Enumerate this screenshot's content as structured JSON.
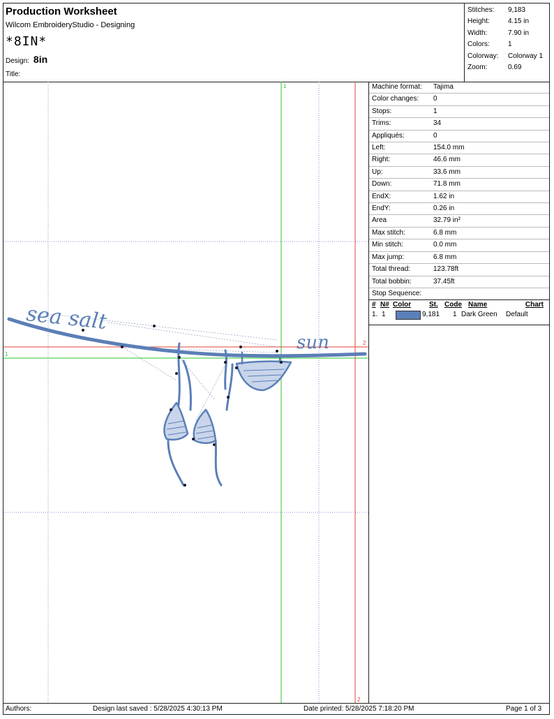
{
  "header": {
    "title": "Production Worksheet",
    "subtitle": "Wilcom EmbroideryStudio - Designing",
    "design_display_name": "*8IN*",
    "design_label": "Design:",
    "design_value": "8in",
    "title_label": "Title:"
  },
  "stats": [
    {
      "label": "Stitches:",
      "value": "9,183"
    },
    {
      "label": "Height:",
      "value": "4.15 in"
    },
    {
      "label": "Width:",
      "value": "7.90 in"
    },
    {
      "label": "Colors:",
      "value": "1"
    },
    {
      "label": "Colorway:",
      "value": "Colorway 1"
    },
    {
      "label": "Zoom:",
      "value": "0.69"
    }
  ],
  "machine_info": [
    {
      "label": "Machine format:",
      "value": "Tajima"
    },
    {
      "label": "Color changes:",
      "value": "0"
    },
    {
      "label": "Stops:",
      "value": "1"
    },
    {
      "label": "Trims:",
      "value": "34"
    },
    {
      "label": "Appliqués:",
      "value": "0"
    },
    {
      "label": "Left:",
      "value": "154.0 mm"
    },
    {
      "label": "Right:",
      "value": "46.6 mm"
    },
    {
      "label": "Up:",
      "value": "33.6 mm"
    },
    {
      "label": "Down:",
      "value": "71.8 mm"
    },
    {
      "label": "EndX:",
      "value": "1.62 in"
    },
    {
      "label": "EndY:",
      "value": "0.26 in"
    },
    {
      "label": "Area",
      "value": "32.79 in²"
    },
    {
      "label": "Max stitch:",
      "value": "6.8 mm"
    },
    {
      "label": "Min stitch:",
      "value": "0.0 mm"
    },
    {
      "label": "Max jump:",
      "value": "6.8 mm"
    },
    {
      "label": "Total thread:",
      "value": "123.78ft"
    },
    {
      "label": "Total bobbin:",
      "value": "37.45ft"
    }
  ],
  "stop_sequence": {
    "title": "Stop Sequence:",
    "columns": {
      "num": "#",
      "n": "N#",
      "color": "Color",
      "st": "St.",
      "code": "Code",
      "name": "Name",
      "chart": "Chart"
    },
    "rows": [
      {
        "num": "1.",
        "n": "1",
        "swatch_color": "#5b7fb7",
        "st": "9,181",
        "code": "1",
        "name": "Dark Green",
        "chart": "Default"
      }
    ]
  },
  "design_preview": {
    "stitch_color": "#5b7fb7",
    "text_left": "sea salt",
    "text_right": "sun",
    "origin_marker_green": "1",
    "origin_marker_red": "2"
  },
  "footer": {
    "authors_label": "Authors:",
    "last_saved": "Design last saved : 5/28/2025 4:30:13 PM",
    "date_printed": "Date printed: 5/28/2025 7:18:20 PM",
    "page": "Page 1 of 3"
  }
}
